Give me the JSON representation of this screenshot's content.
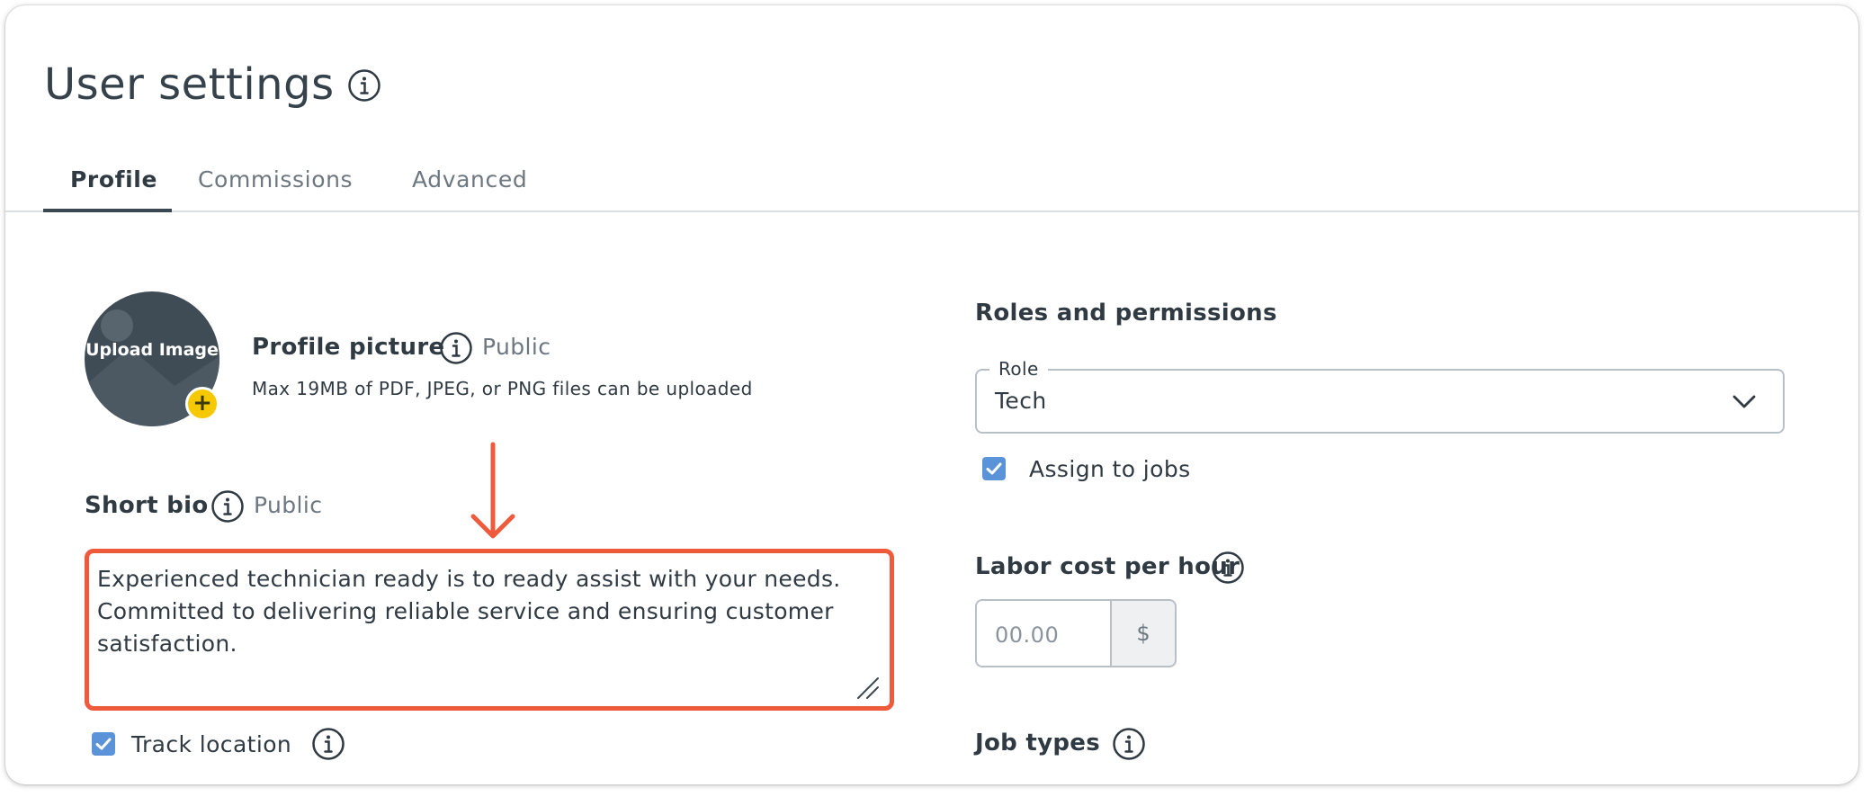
{
  "header": {
    "title": "User settings"
  },
  "tabs": [
    {
      "label": "Profile",
      "active": true
    },
    {
      "label": "Commissions",
      "active": false
    },
    {
      "label": "Advanced",
      "active": false
    }
  ],
  "profile_picture": {
    "upload_label": "Upload Image",
    "heading": "Profile picture",
    "visibility": "Public",
    "help_text": "Max 19MB of PDF, JPEG, or PNG files can be uploaded"
  },
  "short_bio": {
    "heading": "Short bio",
    "visibility": "Public",
    "value": "Experienced technician ready is to ready assist with your needs. Committed to delivering reliable service and ensuring customer satisfaction."
  },
  "track_location": {
    "label": "Track location",
    "checked": true
  },
  "roles": {
    "heading": "Roles and permissions",
    "role_label": "Role",
    "role_value": "Tech",
    "assign_label": "Assign to jobs",
    "assign_checked": true
  },
  "labor_cost": {
    "heading": "Labor cost per hour",
    "placeholder": "00.00",
    "currency": "$"
  },
  "job_types": {
    "heading": "Job types"
  },
  "colors": {
    "accent_highlight": "#f05a3c",
    "checkbox": "#5b93d9",
    "avatar_bg": "#3f4b55",
    "avatar_badge": "#f6c800"
  },
  "icons": [
    "info-icon",
    "chevron-down-icon",
    "plus-icon",
    "check-icon",
    "resize-handle-icon",
    "arrow-down-icon"
  ]
}
